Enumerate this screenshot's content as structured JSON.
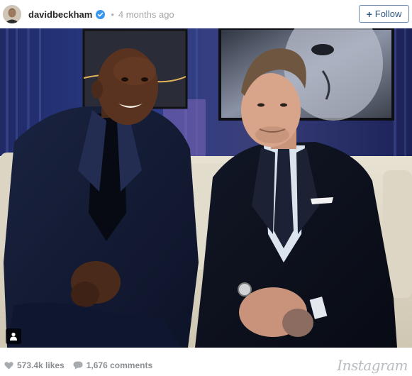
{
  "header": {
    "username": "davidbeckham",
    "separator": "•",
    "timestamp": "4 months ago",
    "follow_label": "Follow",
    "follow_plus": "+"
  },
  "footer": {
    "likes": "573.4k likes",
    "comments": "1,676 comments",
    "brand": "Instagram"
  },
  "colors": {
    "verified_blue": "#3897f0",
    "follow_text": "#2f5985",
    "follow_border": "#6a8bb0",
    "muted_text": "#a5a7aa"
  },
  "icons": {
    "verified": "verified-badge-icon",
    "likes": "heart-icon",
    "comments": "comment-bubble-icon",
    "user_tag": "user-tag-icon"
  }
}
